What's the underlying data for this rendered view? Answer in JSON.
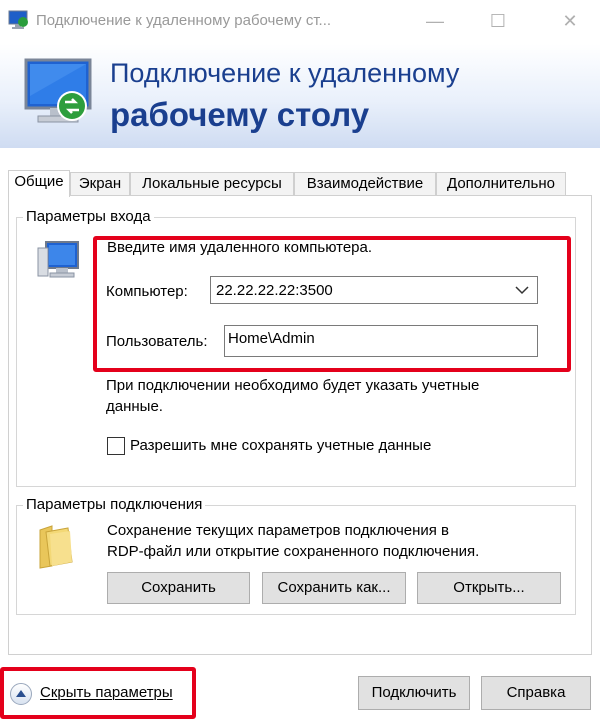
{
  "window": {
    "title": "Подключение к удаленному рабочему ст...",
    "minimize_icon": "—",
    "maximize_icon": "☐",
    "close_icon": "✕"
  },
  "banner": {
    "line1": "Подключение к удаленному",
    "line2": "рабочему столу"
  },
  "tabs": [
    {
      "label": "Общие",
      "active": true
    },
    {
      "label": "Экран",
      "active": false
    },
    {
      "label": "Локальные ресурсы",
      "active": false
    },
    {
      "label": "Взаимодействие",
      "active": false
    },
    {
      "label": "Дополнительно",
      "active": false
    }
  ],
  "login_group": {
    "legend": "Параметры входа",
    "hint": "Введите имя удаленного компьютера.",
    "computer_label": "Компьютер:",
    "computer_value": "22.22.22.22:3500",
    "user_label": "Пользователь:",
    "user_value": "Home\\Admin",
    "note_line1": "При подключении необходимо будет указать учетные",
    "note_line2": "данные.",
    "save_credentials_label": "Разрешить мне сохранять учетные данные",
    "save_credentials_checked": false
  },
  "connection_group": {
    "legend": "Параметры подключения",
    "desc_line1": "Сохранение текущих параметров подключения в",
    "desc_line2": "RDP-файл или открытие сохраненного подключения.",
    "save_label": "Сохранить",
    "save_as_label": "Сохранить как...",
    "open_label": "Открыть..."
  },
  "footer": {
    "hide_options_label": "Скрыть параметры",
    "connect_label": "Подключить",
    "help_label": "Справка"
  },
  "colors": {
    "banner_text": "#1a3f8f",
    "highlight_red": "#e4001b"
  }
}
